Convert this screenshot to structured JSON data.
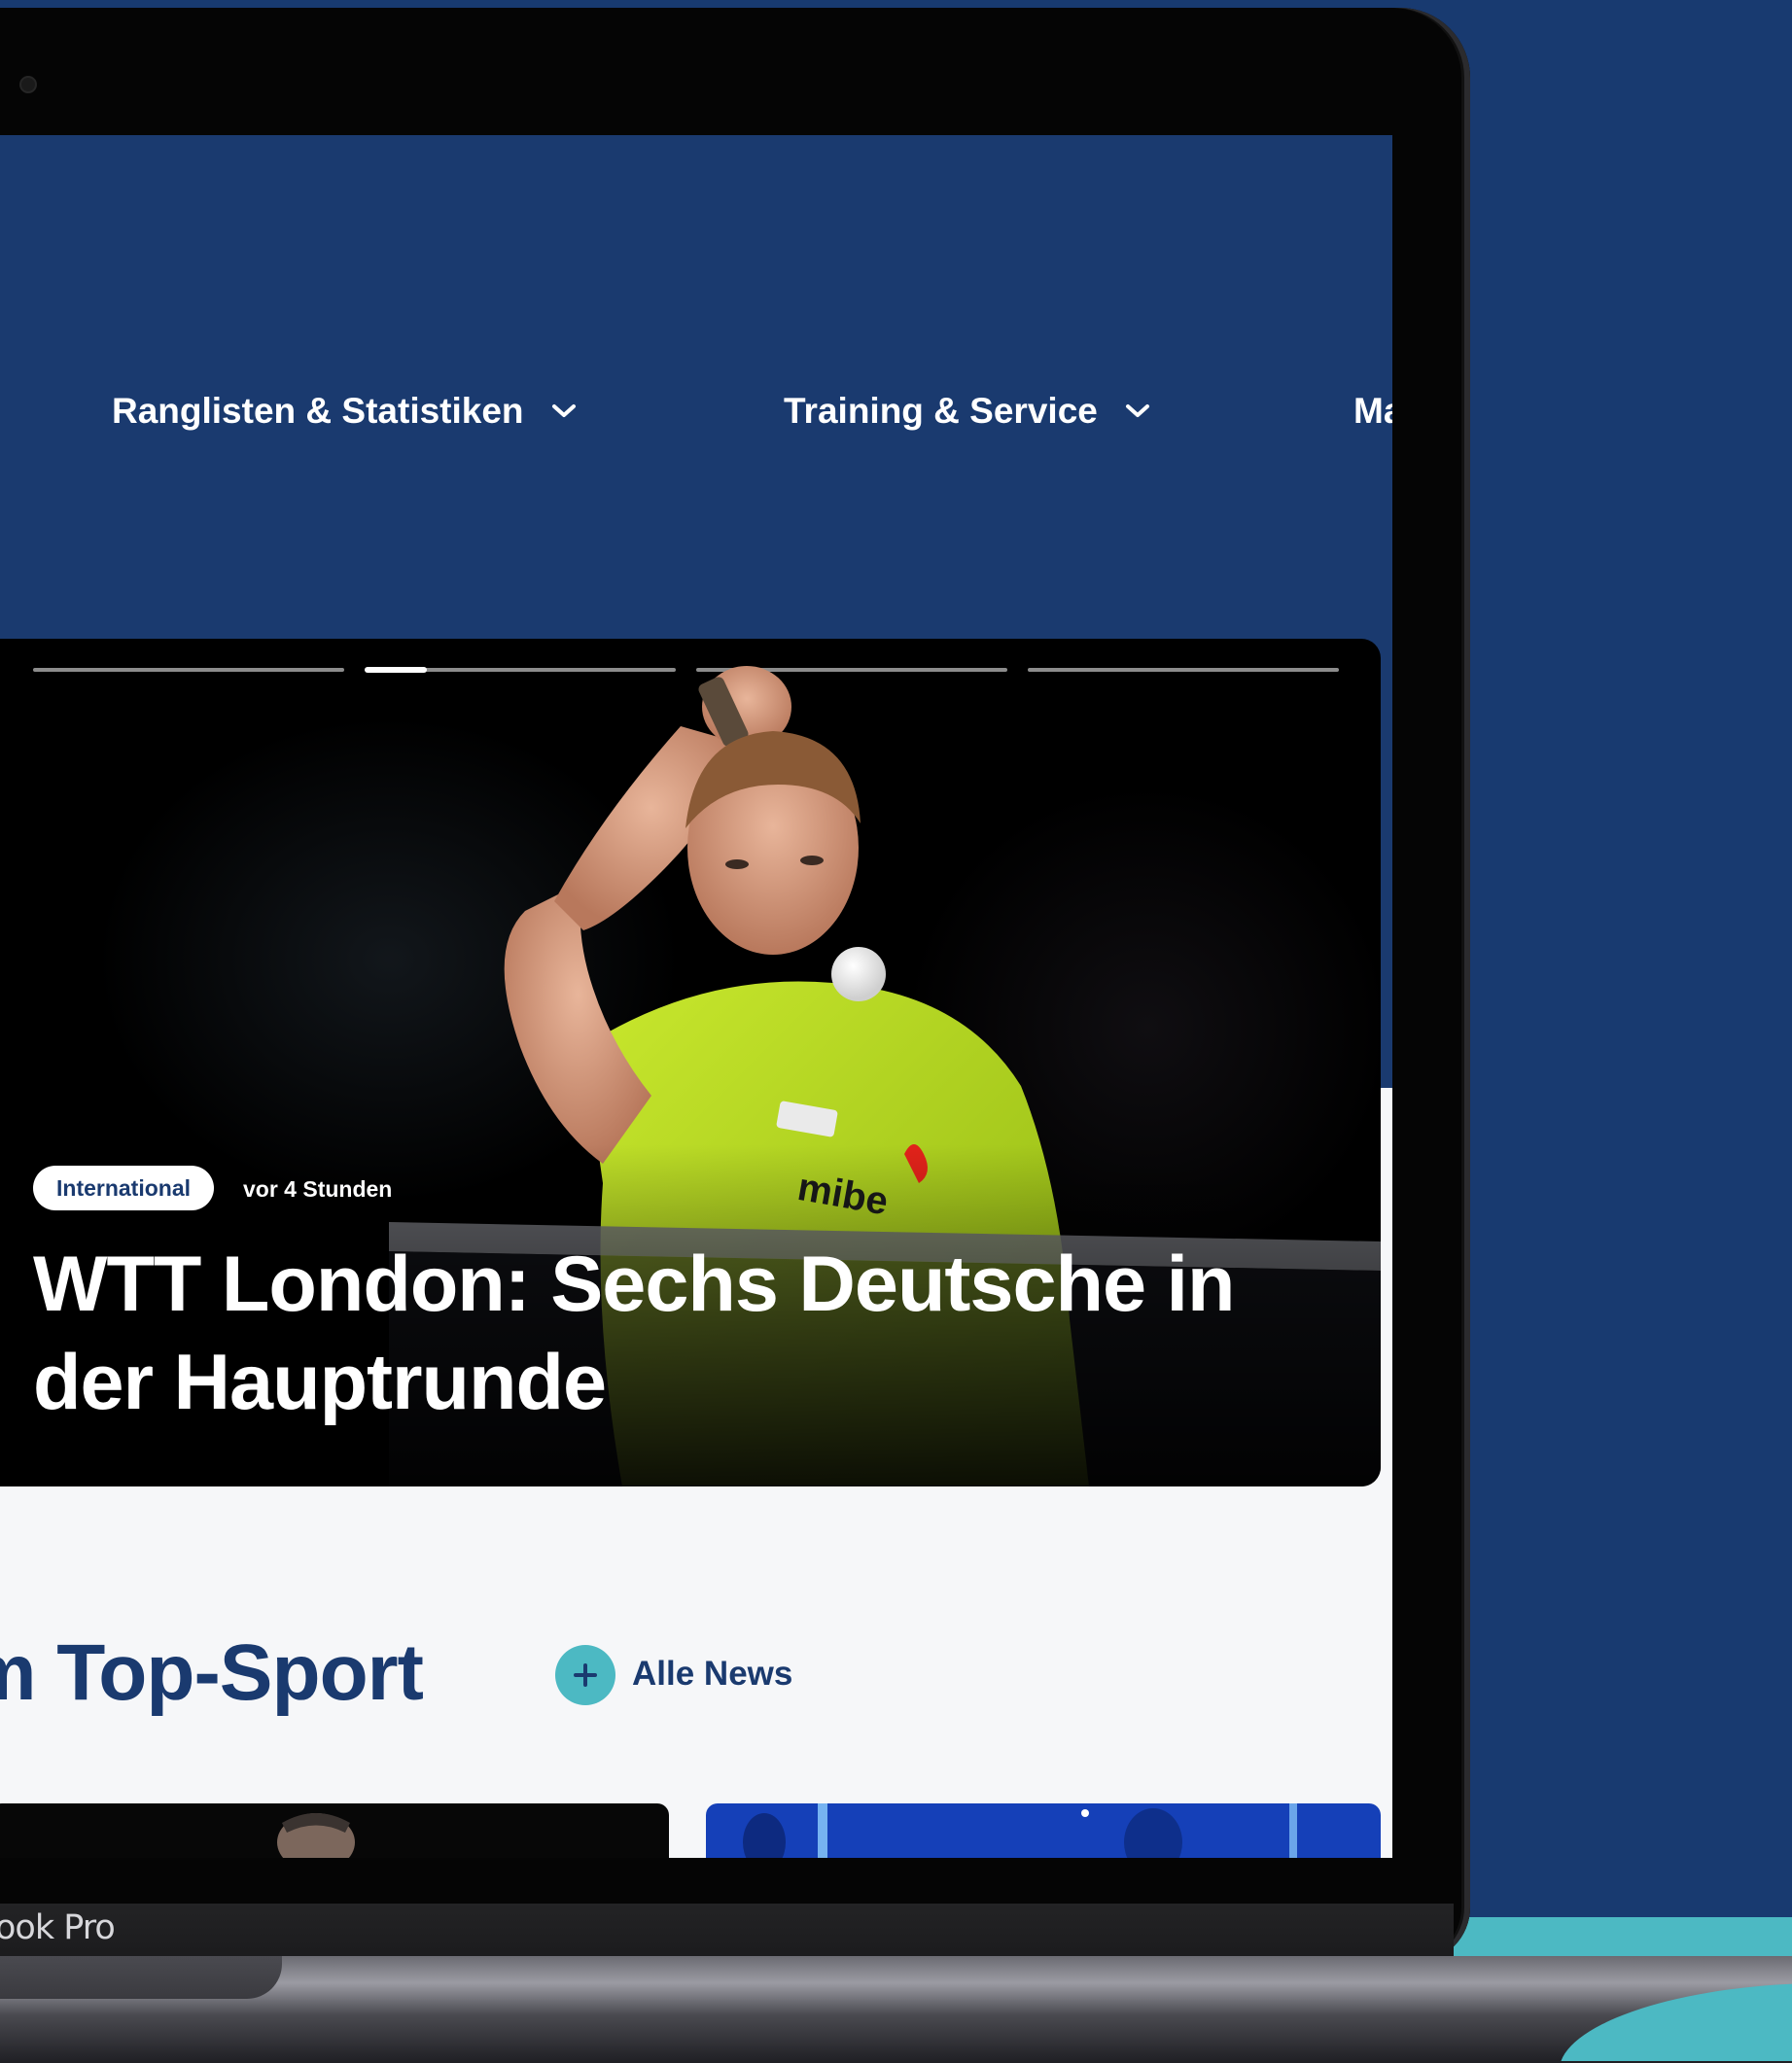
{
  "device": {
    "brand_label": "Book Pro"
  },
  "nav": {
    "items": [
      {
        "label": "Ranglisten & Statistiken"
      },
      {
        "label": "Training & Service"
      },
      {
        "label": "Ma"
      }
    ]
  },
  "hero": {
    "slide_count": 4,
    "active_slide": 2,
    "active_progress": 0.2,
    "tag": "International",
    "time": "vor 4 Stunden",
    "headline": "WTT London: Sechs Deutsche in der Hauptrunde"
  },
  "section": {
    "title": "em Top-Sport",
    "more_label": "Alle News"
  },
  "colors": {
    "brand_blue": "#1a3a6f",
    "accent_teal": "#4cb9c3",
    "page_bg": "#183a70"
  }
}
